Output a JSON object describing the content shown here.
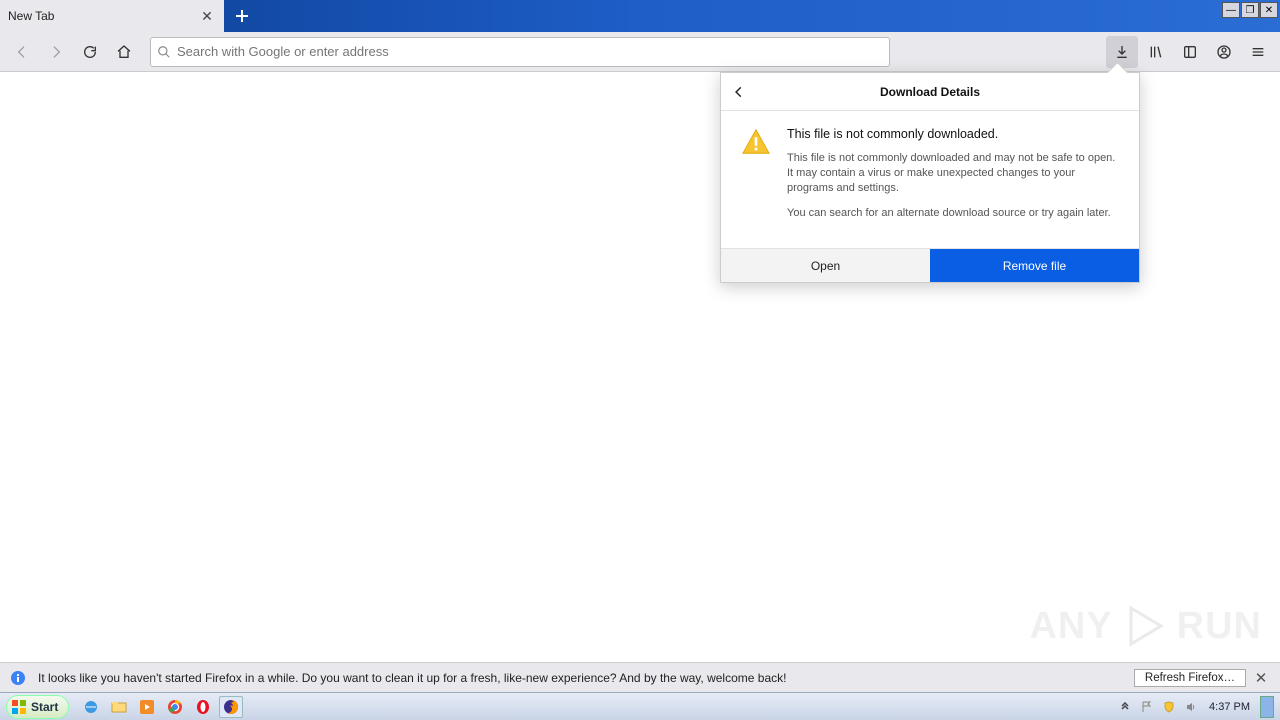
{
  "tab": {
    "title": "New Tab"
  },
  "urlbar": {
    "placeholder": "Search with Google or enter address"
  },
  "popout": {
    "title": "Download Details",
    "heading": "This file is not commonly downloaded.",
    "body1": "This file is not commonly downloaded and may not be safe to open. It may contain a virus or make unexpected changes to your programs and settings.",
    "body2": "You can search for an alternate download source or try again later.",
    "open": "Open",
    "remove": "Remove file"
  },
  "notif": {
    "text": "It looks like you haven't started Firefox in a while. Do you want to clean it up for a fresh, like-new experience? And by the way, welcome back!",
    "refresh": "Refresh Firefox…"
  },
  "start": {
    "label": "Start"
  },
  "tray": {
    "time": "4:37 PM"
  },
  "watermark": {
    "text": "ANY"
  }
}
